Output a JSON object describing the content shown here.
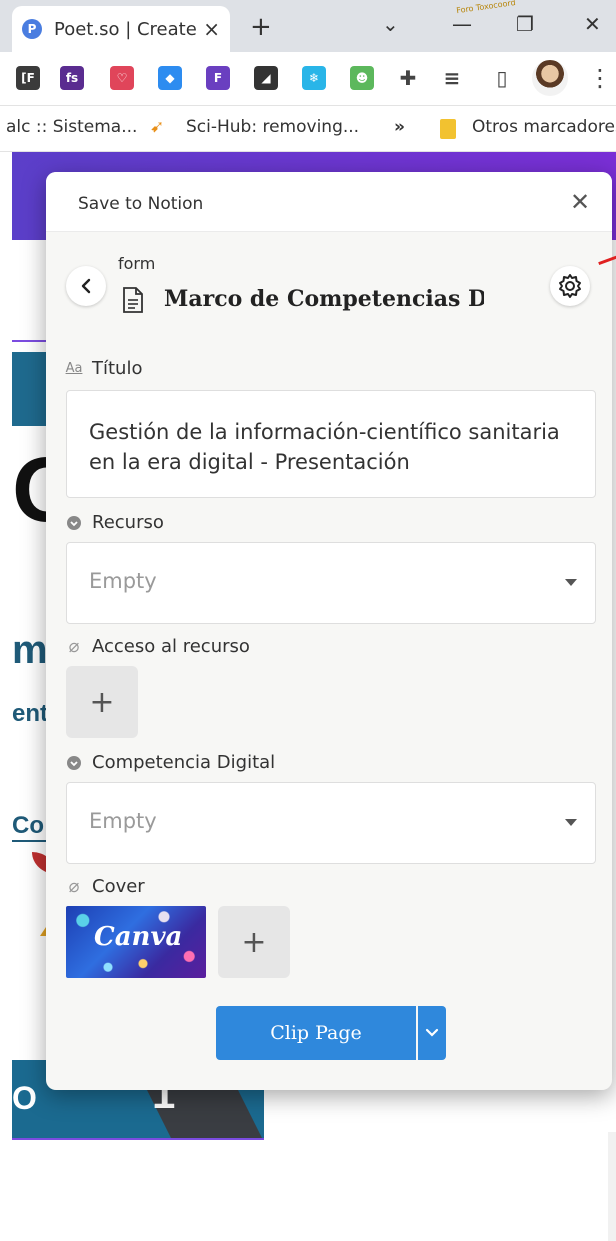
{
  "browser": {
    "tab_title": "Poet.so | Create",
    "tab_favicon": "P",
    "tab_close": "×",
    "new_tab": "+",
    "window_buttons": {
      "dropdown": "⌄",
      "minimize": "—",
      "restore": "❐",
      "close": "✕"
    },
    "stamp_text": "Foro Toxocoord"
  },
  "extensions": [
    {
      "name": "ext-f-icon",
      "label": "[F",
      "color": "#3b3b3b"
    },
    {
      "name": "ext-fs-icon",
      "label": "fs",
      "color": "#5a2c90"
    },
    {
      "name": "pocket-icon",
      "label": "♡",
      "color": "#e0455a"
    },
    {
      "name": "airtable-icon",
      "label": "◆",
      "color": "#2d8cf0"
    },
    {
      "name": "forms-icon",
      "label": "F",
      "color": "#6a3fc0"
    },
    {
      "name": "telegram-icon",
      "label": "◢",
      "color": "#333333"
    },
    {
      "name": "snowflake-icon",
      "label": "❄",
      "color": "#29b5e8"
    },
    {
      "name": "robot-icon",
      "label": "☻",
      "color": "#5cb85c"
    },
    {
      "name": "puzzle-icon",
      "label": "✚",
      "color": "#444444"
    },
    {
      "name": "reading-list-icon",
      "label": "≡",
      "color": "#444444"
    },
    {
      "name": "side-panel-icon",
      "label": "▯",
      "color": "#444444"
    }
  ],
  "menu_dots": "⋮",
  "bookmarks": {
    "item1": "alc :: Sistema...",
    "item2": "Sci-Hub: removing...",
    "more": "»",
    "other": "Otros marcadores"
  },
  "background_page": {
    "big_letter": "O",
    "frag_m": "m",
    "frag_ent": "ent",
    "frag_co": "Co",
    "strip_number": "1",
    "strip_letter": "O"
  },
  "popup": {
    "header_title": "Save to Notion",
    "close": "✕",
    "form_label": "form",
    "database_title": "Marco de Competencias Di",
    "fields": {
      "titulo": {
        "label": "Título",
        "icon_text": "Aa",
        "value": "Gestión de la información-científico sanitaria en la era digital - Presentación"
      },
      "recurso": {
        "label": "Recurso",
        "value": "Empty"
      },
      "acceso": {
        "label": "Acceso al recurso",
        "add": "+"
      },
      "competencia": {
        "label": "Competencia Digital",
        "value": "Empty"
      },
      "cover": {
        "label": "Cover",
        "thumb_text": "Canva",
        "add": "+"
      }
    },
    "clip_button": "Clip Page"
  },
  "colors": {
    "accent_blue": "#2f88dc",
    "purple_band": "#6a36d0",
    "popup_bg": "#f7f7f5"
  }
}
